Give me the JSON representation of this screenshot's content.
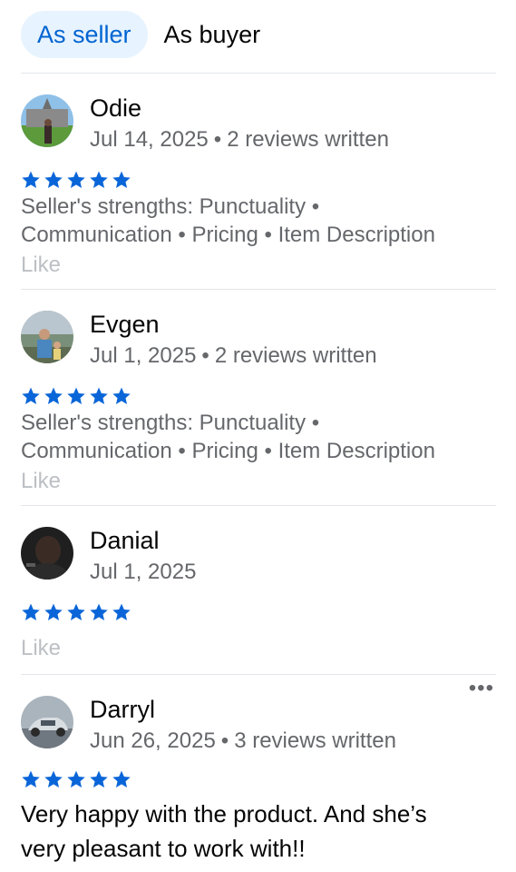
{
  "tabs": [
    {
      "label": "As seller",
      "active": true
    },
    {
      "label": "As buyer",
      "active": false
    }
  ],
  "accent_color": "#0a66d8",
  "reviews": [
    {
      "name": "Odie",
      "date": "Jul 14, 2025",
      "reviews_written": "2 reviews written",
      "stars": 5,
      "text_line1": "Seller's strengths: Punctuality •",
      "text_line2": "Communication • Pricing • Item Description",
      "like": "Like"
    },
    {
      "name": "Evgen",
      "date": "Jul 1, 2025",
      "reviews_written": "2 reviews written",
      "stars": 5,
      "text_line1": "Seller's strengths: Punctuality •",
      "text_line2": "Communication • Pricing • Item Description",
      "like": "Like"
    },
    {
      "name": "Danial",
      "date": "Jul 1, 2025",
      "stars": 5,
      "like": "Like"
    },
    {
      "name": "Darryl",
      "date": "Jun 26, 2025",
      "reviews_written": "3 reviews written",
      "stars": 5,
      "text_line1": "Very happy with the product. And she’s",
      "text_line2": "very pleasant to work with!!",
      "more": "•••"
    }
  ]
}
